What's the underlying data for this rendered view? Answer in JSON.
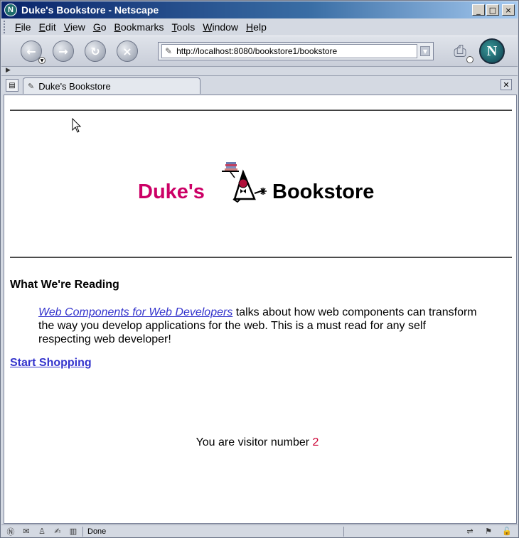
{
  "window": {
    "title": "Duke's Bookstore - Netscape",
    "min_glyph": "_",
    "max_glyph": "□",
    "close_glyph": "×"
  },
  "menu": [
    {
      "label": "File",
      "accel": "F",
      "rest": "ile"
    },
    {
      "label": "Edit",
      "accel": "E",
      "rest": "dit"
    },
    {
      "label": "View",
      "accel": "V",
      "rest": "iew"
    },
    {
      "label": "Go",
      "accel": "G",
      "rest": "o"
    },
    {
      "label": "Bookmarks",
      "accel": "B",
      "rest": "ookmarks"
    },
    {
      "label": "Tools",
      "accel": "T",
      "rest": "ools"
    },
    {
      "label": "Window",
      "accel": "W",
      "rest": "indow"
    },
    {
      "label": "Help",
      "accel": "H",
      "rest": "elp"
    }
  ],
  "nav": {
    "back_glyph": "←",
    "forward_glyph": "→",
    "reload_glyph": "↻",
    "stop_glyph": "×",
    "url": "http://localhost:8080/bookstore1/bookstore"
  },
  "tabs": [
    {
      "label": "Duke's Bookstore"
    }
  ],
  "page": {
    "banner_left": "Duke's",
    "banner_right": "Bookstore",
    "section_heading": "What We're Reading",
    "book_link": "Web Components for Web Developers",
    "blurb": " talks about how web components can transform the way you develop applications for the web. This is a must read for any self respecting web developer!",
    "start_link": "Start Shopping",
    "visitor_text": "You are visitor number ",
    "visitor_number": "2"
  },
  "status": {
    "text": "Done"
  },
  "colors": {
    "accent_pink": "#cc0066",
    "link": "#3333cc",
    "visitor_number": "#cc0033"
  }
}
